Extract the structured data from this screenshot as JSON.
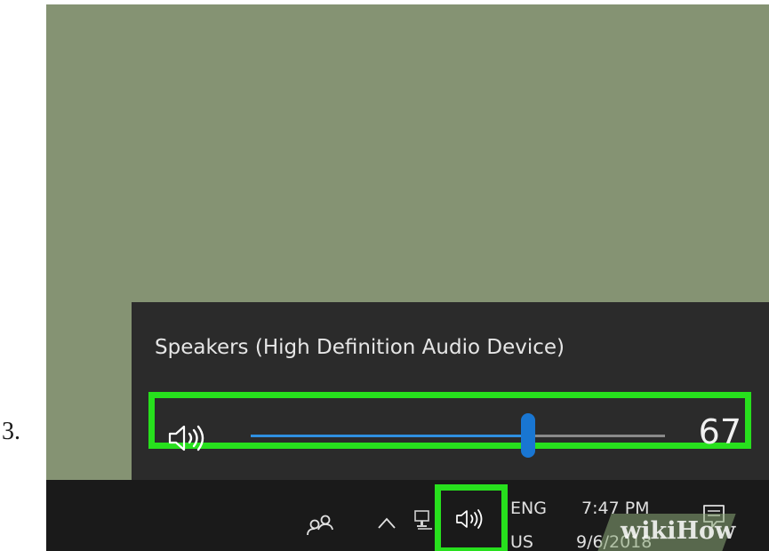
{
  "step": {
    "number": "3."
  },
  "volume_flyout": {
    "device_name": "Speakers (High Definition Audio Device)",
    "volume_value": "67",
    "volume_level": 0.67,
    "speaker_icon": "speaker-volume-icon"
  },
  "taskbar": {
    "tray_icons": [
      "people-icon",
      "chevron-up-icon",
      "network-icon",
      "speaker-volume-icon",
      "notification-icon"
    ],
    "language_top": "ENG",
    "language_bottom": "US",
    "time": "7:47 PM",
    "date": "9/6/2018"
  },
  "watermark": {
    "text": "wikiHow"
  },
  "colors": {
    "desktop": "#859373",
    "flyout_bg": "#2b2b2b",
    "highlight": "#27e01d",
    "slider_accent": "#1976d2",
    "taskbar_bg": "#1a1a1a"
  }
}
